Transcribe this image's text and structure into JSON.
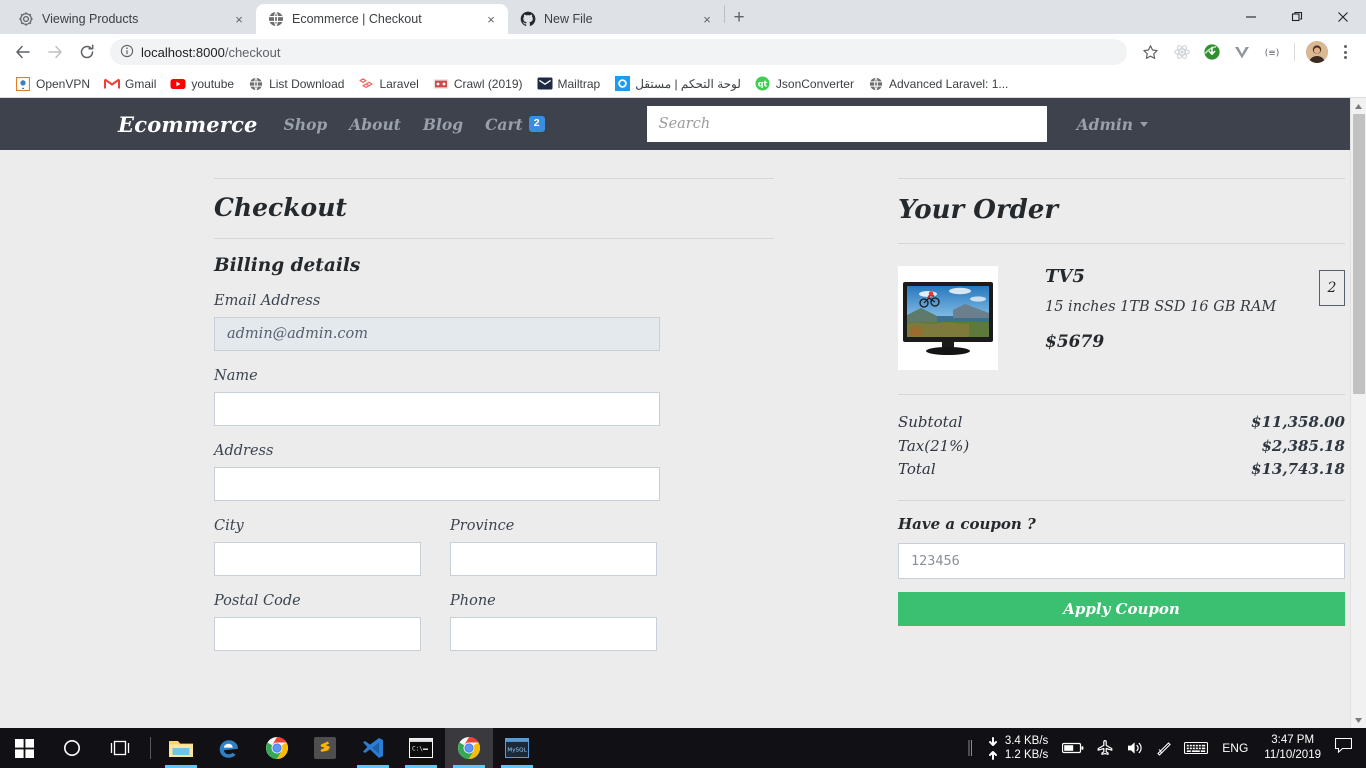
{
  "browser": {
    "tabs": [
      {
        "title": "Viewing Products",
        "favicon": "gear-icon",
        "active": false
      },
      {
        "title": "Ecommerce | Checkout",
        "favicon": "globe-icon",
        "active": true
      },
      {
        "title": "New File",
        "favicon": "github-icon",
        "active": false
      }
    ],
    "new_tab_label": "+",
    "close_label": "×",
    "window_controls": {
      "minimize": "minimize-icon",
      "maximize": "maximize-icon",
      "close": "close-icon"
    },
    "toolbar": {
      "back": "back-arrow-icon",
      "forward": "forward-arrow-icon",
      "reload": "reload-icon",
      "info_icon": "page-info-icon",
      "url_host": "localhost:8000",
      "url_path": "/checkout",
      "bookmark_icon": "star-icon",
      "extensions": [
        "react-devtools-icon",
        "idm-icon",
        "vue-devtools-icon",
        "extension-icon"
      ],
      "profile": "avatar",
      "menu": "three-dot-menu-icon"
    },
    "bookmarks": [
      {
        "label": "OpenVPN",
        "icon": "openvpn-icon"
      },
      {
        "label": "Gmail",
        "icon": "gmail-icon"
      },
      {
        "label": "youtube",
        "icon": "youtube-icon"
      },
      {
        "label": "List Download",
        "icon": "globe-icon"
      },
      {
        "label": "Laravel",
        "icon": "laravel-icon"
      },
      {
        "label": "Crawl (2019)",
        "icon": "film-icon"
      },
      {
        "label": "Mailtrap",
        "icon": "mailtrap-icon"
      },
      {
        "label": "لوحة التحكم | مستقل",
        "icon": "mostaql-icon"
      },
      {
        "label": "JsonConverter",
        "icon": "qt-icon"
      },
      {
        "label": "Advanced Laravel: 1...",
        "icon": "globe-icon"
      }
    ]
  },
  "site": {
    "brand": "Ecommerce",
    "nav": [
      {
        "label": "Shop"
      },
      {
        "label": "About"
      },
      {
        "label": "Blog"
      },
      {
        "label": "Cart",
        "badge": "2"
      }
    ],
    "search_placeholder": "Search",
    "search_value": "",
    "admin_label": "Admin"
  },
  "checkout": {
    "title": "Checkout",
    "section_title": "Billing details",
    "fields": {
      "email_label": "Email Address",
      "email_value": "admin@admin.com",
      "name_label": "Name",
      "name_value": "",
      "address_label": "Address",
      "address_value": "",
      "city_label": "City",
      "city_value": "",
      "province_label": "Province",
      "province_value": "",
      "postal_label": "Postal Code",
      "postal_value": "",
      "phone_label": "Phone",
      "phone_value": ""
    }
  },
  "order": {
    "title": "Your Order",
    "items": [
      {
        "name": "TV5",
        "description": "15 inches 1TB SSD 16 GB RAM",
        "price": "$5679",
        "quantity": "2",
        "image_alt": "tv-product-thumbnail"
      }
    ],
    "totals": [
      {
        "label": "Subtotal",
        "value": "$11,358.00"
      },
      {
        "label": "Tax(21%)",
        "value": "$2,385.18"
      },
      {
        "label": "Total",
        "value": "$13,743.18"
      }
    ],
    "coupon_label": "Have a coupon ?",
    "coupon_placeholder": "123456",
    "coupon_value": "",
    "apply_label": "Apply Coupon"
  },
  "taskbar": {
    "apps": [
      {
        "name": "start-button",
        "icon": "windows-logo"
      },
      {
        "name": "cortana-search",
        "icon": "circle-icon"
      },
      {
        "name": "task-view",
        "icon": "task-view-icon"
      },
      {
        "name": "file-explorer",
        "icon": "folder-icon"
      },
      {
        "name": "microsoft-edge",
        "icon": "edge-icon"
      },
      {
        "name": "google-chrome",
        "icon": "chrome-icon"
      },
      {
        "name": "sublime-text",
        "icon": "sublime-icon"
      },
      {
        "name": "visual-studio-code",
        "icon": "vscode-icon"
      },
      {
        "name": "command-prompt",
        "icon": "cmd-icon"
      },
      {
        "name": "google-chrome-active",
        "icon": "chrome-icon"
      },
      {
        "name": "mysql-workbench",
        "icon": "mysql-icon"
      }
    ],
    "network": {
      "download": "3.4 KB/s",
      "upload": "1.2 KB/s"
    },
    "language": "ENG",
    "time": "3:47 PM",
    "date": "11/10/2019"
  },
  "colors": {
    "navbar": "#3d424d",
    "page_bg": "#ececec",
    "accent_green": "#3bbf71",
    "badge_blue": "#3c8dde"
  }
}
